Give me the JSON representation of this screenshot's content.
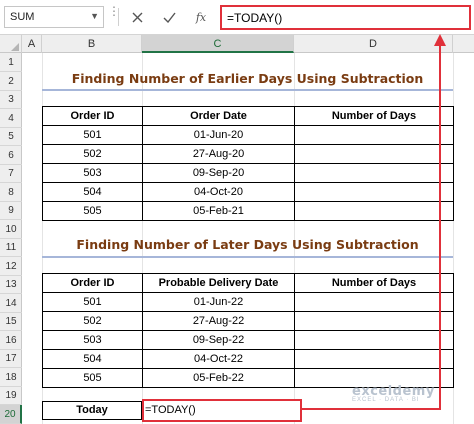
{
  "name_box": {
    "value": "SUM",
    "arrow_icon": "chevron-down-icon"
  },
  "formula_bar": {
    "cancel_icon": "close-icon",
    "enter_icon": "check-icon",
    "function_label": "fx",
    "formula": "=TODAY()"
  },
  "columns": [
    "A",
    "B",
    "C",
    "D"
  ],
  "rows": [
    "1",
    "2",
    "3",
    "4",
    "5",
    "6",
    "7",
    "8",
    "9",
    "10",
    "11",
    "12",
    "13",
    "14",
    "15",
    "16",
    "17",
    "18",
    "19",
    "20"
  ],
  "selected": {
    "column": "C",
    "row": "20"
  },
  "section1": {
    "title": "Finding Number of Earlier Days Using Subtraction",
    "headers": [
      "Order ID",
      "Order Date",
      "Number of Days"
    ],
    "rows": [
      [
        "501",
        "01-Jun-20",
        ""
      ],
      [
        "502",
        "27-Aug-20",
        ""
      ],
      [
        "503",
        "09-Sep-20",
        ""
      ],
      [
        "504",
        "04-Oct-20",
        ""
      ],
      [
        "505",
        "05-Feb-21",
        ""
      ]
    ]
  },
  "section2": {
    "title": "Finding Number of Later Days Using Subtraction",
    "headers": [
      "Order ID",
      "Probable Delivery Date",
      "Number of Days"
    ],
    "rows": [
      [
        "501",
        "01-Jun-22",
        ""
      ],
      [
        "502",
        "27-Aug-22",
        ""
      ],
      [
        "503",
        "09-Sep-22",
        ""
      ],
      [
        "504",
        "04-Oct-22",
        ""
      ],
      [
        "505",
        "05-Feb-22",
        ""
      ]
    ]
  },
  "today": {
    "label": "Today",
    "cell_value": "=TODAY()"
  },
  "watermark": {
    "name": "exceldemy",
    "tagline": "EXCEL · DATA · BI"
  },
  "colors": {
    "title_text": "#7a3c12",
    "title_rule": "#a6b6d9",
    "highlight_box": "#e0303a",
    "selection": "#217346"
  }
}
